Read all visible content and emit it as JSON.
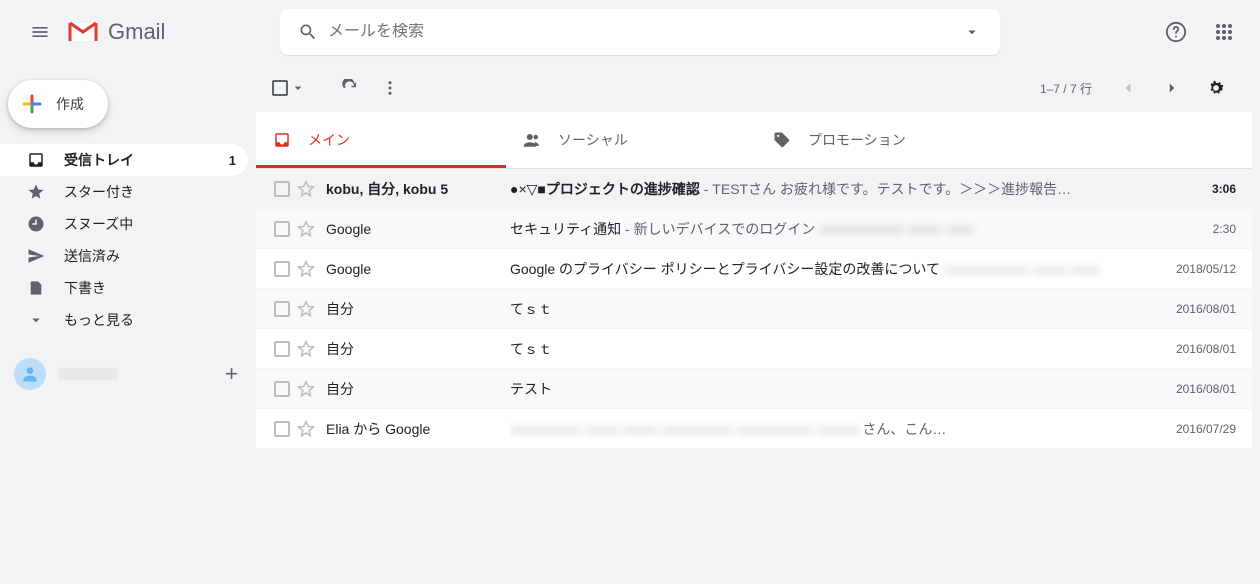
{
  "header": {
    "product_name": "Gmail",
    "search_placeholder": "メールを検索"
  },
  "compose_label": "作成",
  "sidebar": [
    {
      "icon": "inbox",
      "label": "受信トレイ",
      "count": "1",
      "active": true
    },
    {
      "icon": "star",
      "label": "スター付き"
    },
    {
      "icon": "clock",
      "label": "スヌーズ中"
    },
    {
      "icon": "send",
      "label": "送信済み"
    },
    {
      "icon": "file",
      "label": "下書き"
    },
    {
      "icon": "more",
      "label": "もっと見る"
    }
  ],
  "toolbar": {
    "page_info": "1–7 / 7 行"
  },
  "tabs": [
    {
      "id": "primary",
      "label": "メイン",
      "active": true
    },
    {
      "id": "social",
      "label": "ソーシャル"
    },
    {
      "id": "promotions",
      "label": "プロモーション"
    }
  ],
  "messages": [
    {
      "unread": true,
      "sender_html": "kobu, 自分, <b>kobu</b> 5",
      "subject_prefix": "●×▽■",
      "subject_bold": "プロジェクトの進捗確認",
      "snippet": " - TESTさん お疲れ様です。テストです。＞＞＞進捗報告…",
      "date": "3:06"
    },
    {
      "sender": "Google",
      "subject": "セキュリティ通知",
      "snippet": " - 新しいデバイスでのログイン ",
      "blurred_tail": true,
      "date": "2:30"
    },
    {
      "sender": "Google",
      "subject": "Google のプライバシー ポリシーとプライバシー設定の改善について",
      "blurred_tail": true,
      "date": "2018/05/12"
    },
    {
      "sender": "自分",
      "subject": "てｓｔ",
      "date": "2016/08/01"
    },
    {
      "sender": "自分",
      "subject": "てｓｔ",
      "date": "2016/08/01"
    },
    {
      "sender": "自分",
      "subject": "テスト",
      "date": "2016/08/01"
    },
    {
      "sender": "Elia から Google",
      "blurred_subject": true,
      "snippet_tail": " さん、こん…",
      "date": "2016/07/29"
    }
  ]
}
